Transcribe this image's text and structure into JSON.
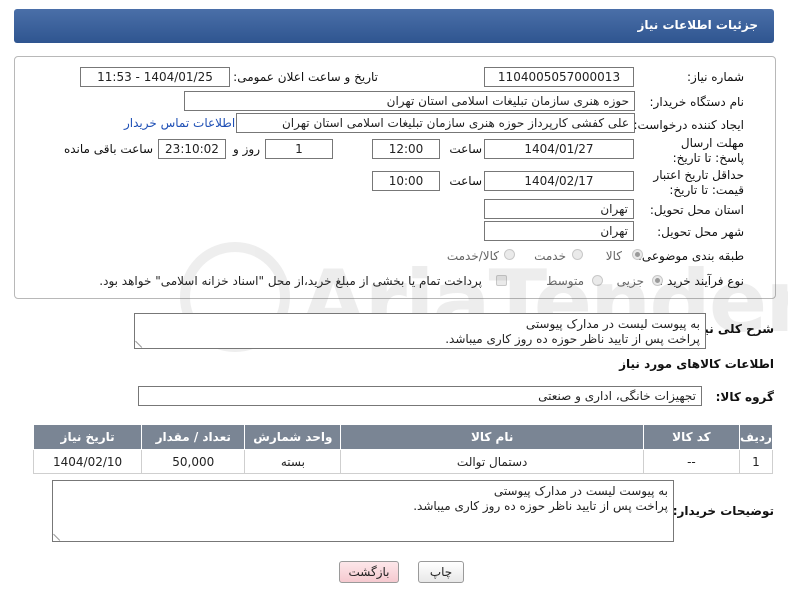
{
  "header": {
    "title": "جزئیات اطلاعات نیاز"
  },
  "form": {
    "need_number_label": "شماره نیاز:",
    "need_number": "1104005057000013",
    "announce_datetime_label": "تاریخ و ساعت اعلان عمومی:",
    "announce_datetime": "1404/01/25 - 11:53",
    "buyer_org_label": "نام دستگاه خریدار:",
    "buyer_org": "حوزه هنری سازمان تبلیغات اسلامی استان تهران",
    "creator_label": "ایجاد کننده درخواست:",
    "creator": "علی کفشی کارپرداز حوزه هنری سازمان تبلیغات اسلامی استان تهران",
    "contact_link": "اطلاعات تماس خریدار",
    "reply_deadline_label": "مهلت ارسال پاسخ: تا تاریخ:",
    "reply_date": "1404/01/27",
    "time_label": "ساعت",
    "reply_time": "12:00",
    "days_value": "1",
    "days_label": "روز و",
    "remaining_time": "23:10:02",
    "remaining_label": "ساعت باقی مانده",
    "price_validity_label": "حداقل تاریخ اعتبار قیمت: تا تاریخ:",
    "validity_date": "1404/02/17",
    "validity_time": "10:00",
    "delivery_province_label": "استان محل تحویل:",
    "delivery_province": "تهران",
    "delivery_city_label": "شهر محل تحویل:",
    "delivery_city": "تهران",
    "category_label": "طبقه بندی موضوعی:",
    "category_options": {
      "goods": "کالا",
      "service": "خدمت",
      "goods_service": "کالا/خدمت"
    },
    "purchase_type_label": "نوع فرآیند خرید :",
    "purchase_options": {
      "minor": "جزیی",
      "medium": "متوسط"
    },
    "payment_note": "پرداخت تمام یا بخشی از مبلغ خرید،از محل \"اسناد خزانه اسلامی\" خواهد بود."
  },
  "description": {
    "label": "شرح کلی نیاز:",
    "line1": "به پیوست لیست در مدارک پیوستی",
    "line2": "پراخت پس از تایید ناظر حوزه ده روز کاری میباشد."
  },
  "goods_info": {
    "title": "اطلاعات کالاهای مورد نیاز",
    "group_label": "گروه کالا:",
    "group_value": "تجهیزات خانگی، اداری و صنعتی"
  },
  "table": {
    "headers": [
      "ردیف",
      "کد کالا",
      "نام کالا",
      "واحد شمارش",
      "تعداد / مقدار",
      "تاریخ نیاز"
    ],
    "rows": [
      [
        "1",
        "--",
        "دستمال توالت",
        "بسته",
        "50,000",
        "1404/02/10"
      ]
    ]
  },
  "buyer_notes": {
    "label": "توضیحات خریدار:",
    "line1": "به پیوست لیست در مدارک پیوستی",
    "line2": "پراخت پس از تایید ناظر حوزه ده روز کاری میباشد."
  },
  "buttons": {
    "print": "چاپ",
    "back": "بازگشت"
  },
  "watermark": "AriaTender.neT"
}
